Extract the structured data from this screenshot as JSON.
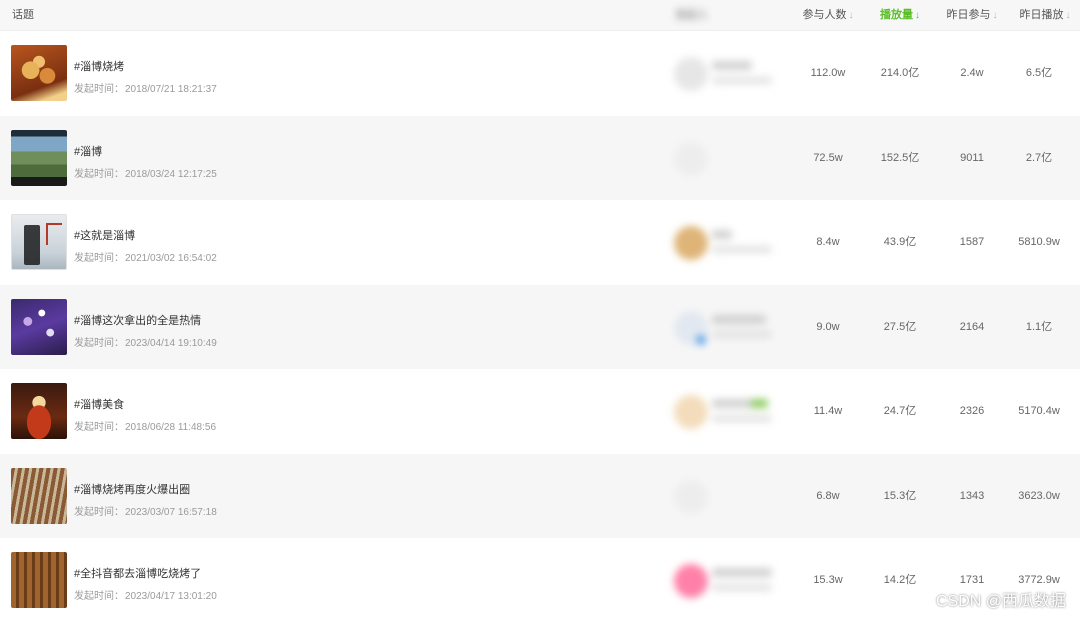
{
  "header": {
    "topic": "话题",
    "creator": "发起人",
    "participants": "参与人数",
    "plays": "播放量",
    "yesterday_participants": "昨日参与",
    "yesterday_plays": "昨日播放",
    "sort_arrow": "↓",
    "active_color": "#5cbf2a"
  },
  "date_label": "发起时间：",
  "rows": [
    {
      "title": "#淄博烧烤",
      "date": "2018/07/21 18:21:37",
      "participants": "112.0w",
      "plays": "214.0亿",
      "yesterday_participants": "2.4w",
      "yesterday_plays": "6.5亿"
    },
    {
      "title": "#淄博",
      "date": "2018/03/24 12:17:25",
      "participants": "72.5w",
      "plays": "152.5亿",
      "yesterday_participants": "9011",
      "yesterday_plays": "2.7亿"
    },
    {
      "title": "#这就是淄博",
      "date": "2021/03/02 16:54:02",
      "participants": "8.4w",
      "plays": "43.9亿",
      "yesterday_participants": "1587",
      "yesterday_plays": "5810.9w"
    },
    {
      "title": "#淄博这次拿出的全是热情",
      "date": "2023/04/14 19:10:49",
      "participants": "9.0w",
      "plays": "27.5亿",
      "yesterday_participants": "2164",
      "yesterday_plays": "1.1亿"
    },
    {
      "title": "#淄博美食",
      "date": "2018/06/28 11:48:56",
      "participants": "11.4w",
      "plays": "24.7亿",
      "yesterday_participants": "2326",
      "yesterday_plays": "5170.4w"
    },
    {
      "title": "#淄博烧烤再度火爆出圈",
      "date": "2023/03/07 16:57:18",
      "participants": "6.8w",
      "plays": "15.3亿",
      "yesterday_participants": "1343",
      "yesterday_plays": "3623.0w"
    },
    {
      "title": "#全抖音都去淄博吃烧烤了",
      "date": "2023/04/17 13:01:20",
      "participants": "15.3w",
      "plays": "14.2亿",
      "yesterday_participants": "1731",
      "yesterday_plays": "3772.9w"
    }
  ],
  "watermark": "CSDN @西瓜数据"
}
